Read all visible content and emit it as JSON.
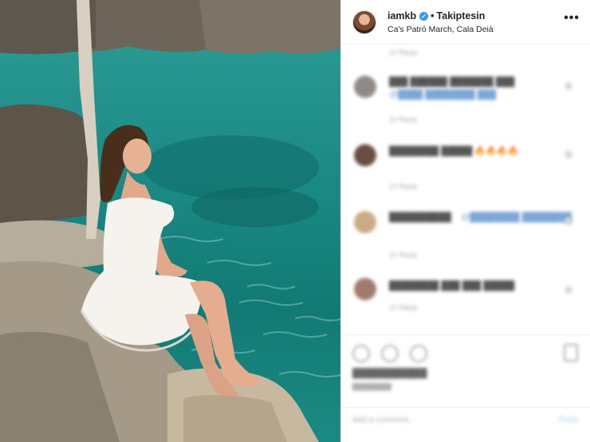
{
  "post": {
    "username": "iamkb",
    "follow_label": "Takiptesin",
    "location": "Ca's Patró March, Cala Deià",
    "separator": "•",
    "more_label": "•••"
  },
  "icons": {
    "verified": "verified-badge-icon",
    "more": "more-options-icon",
    "like": "heart-icon",
    "comment": "comment-icon",
    "share": "share-icon",
    "save": "bookmark-icon"
  },
  "comments": [
    {
      "text": "███ ██████ ███████ ███",
      "link": "@████ ████████ ███",
      "meta": "1h  Reply"
    },
    {
      "text": "████████ █████ 🔥🔥🔥🔥",
      "link": "",
      "meta": "1h  Reply"
    },
    {
      "text": "██████████",
      "link": "@████████ ████████",
      "meta": "1h  Reply"
    },
    {
      "text": "████████ ███ ███ █████",
      "link": "",
      "meta": "1h  Reply"
    }
  ],
  "footer": {
    "likes_text": "████████████",
    "date_text": "████████",
    "add_comment_placeholder": "Add a comment…",
    "post_button": "Post"
  },
  "colors": {
    "water": "#1b8a86",
    "verified": "#3897f0",
    "divider": "#efefef"
  }
}
